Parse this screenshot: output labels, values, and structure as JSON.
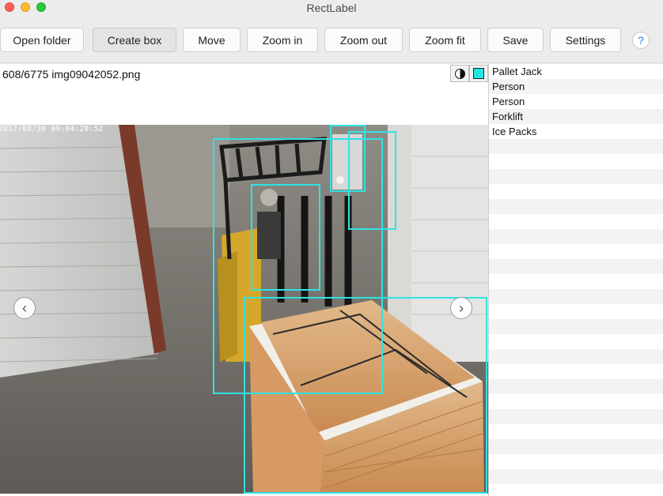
{
  "window": {
    "title": "RectLabel"
  },
  "toolbar": {
    "open_folder": "Open folder",
    "create_box": "Create box",
    "move": "Move",
    "zoom_in": "Zoom in",
    "zoom_out": "Zoom out",
    "zoom_fit": "Zoom fit",
    "save": "Save",
    "settings": "Settings",
    "help": "?"
  },
  "editor": {
    "file_info": "608/6775 img09042052.png",
    "timestamp": "2017/08/30 09:04:20:52",
    "box_color": "#2fe3e3",
    "prev_arrow": "‹",
    "next_arrow": "›"
  },
  "labels": [
    "Pallet Jack",
    "Person",
    "Person",
    "Forklift",
    "Ice Packs"
  ],
  "colors": {
    "accent": "#2b7de9",
    "box": "#2fe3e3"
  }
}
